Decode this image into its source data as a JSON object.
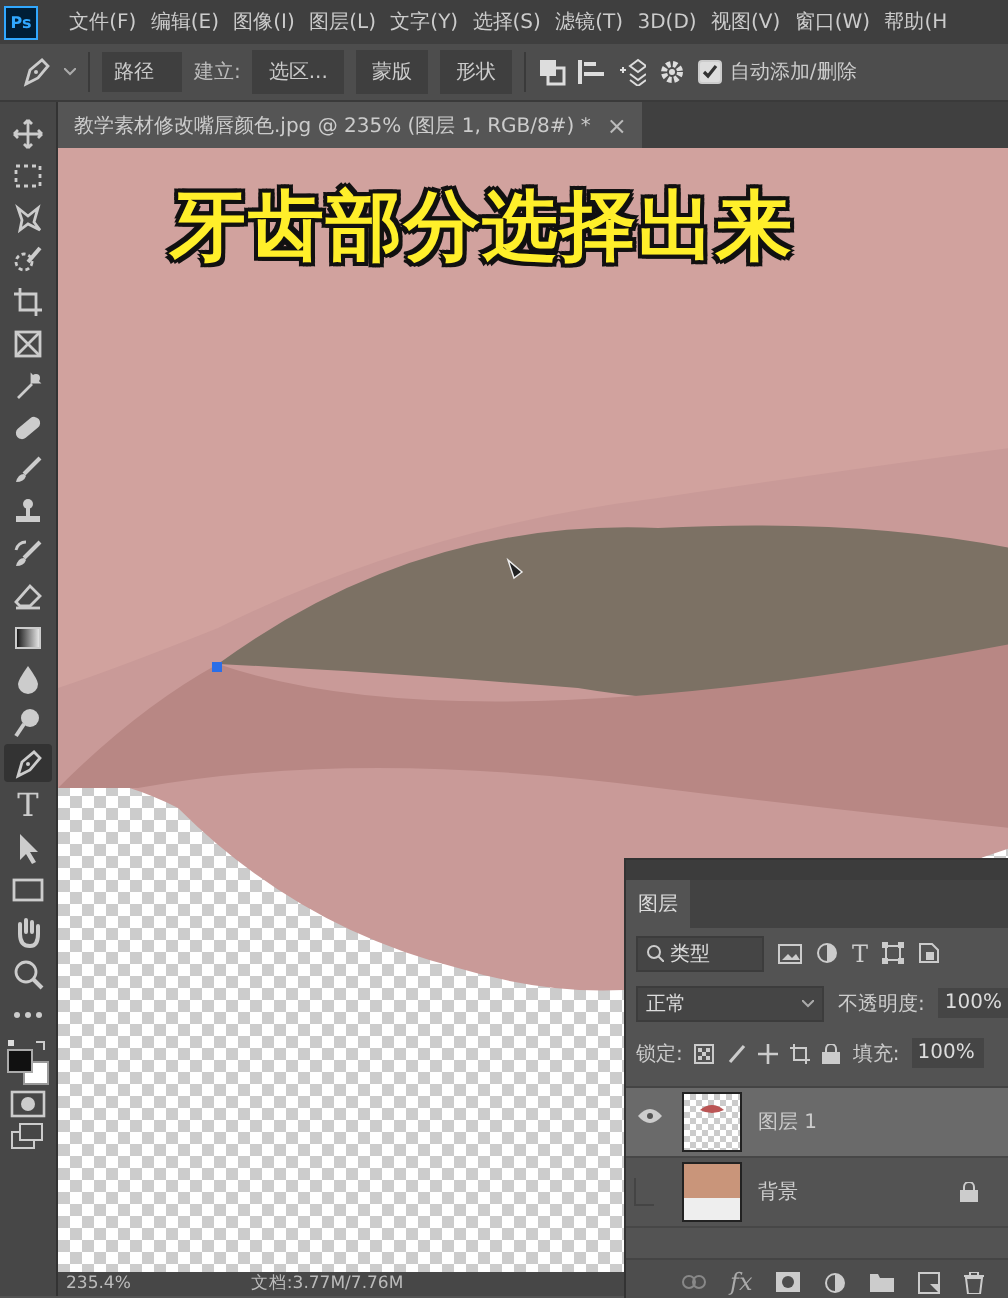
{
  "app_logo": "Ps",
  "menu": [
    "文件(F)",
    "编辑(E)",
    "图像(I)",
    "图层(L)",
    "文字(Y)",
    "选择(S)",
    "滤镜(T)",
    "3D(D)",
    "视图(V)",
    "窗口(W)",
    "帮助(H"
  ],
  "options_bar": {
    "mode": "路径",
    "make_label": "建立:",
    "buttons": [
      "选区...",
      "蒙版",
      "形状"
    ],
    "auto_add_delete": {
      "label": "自动添加/删除",
      "checked": true
    }
  },
  "document_tab": {
    "title": "教学素材修改嘴唇颜色.jpg @ 235% (图层 1, RGB/8#) *",
    "close": "×"
  },
  "tools": [
    {
      "kind": "move",
      "selected": false
    },
    {
      "kind": "marquee",
      "selected": false
    },
    {
      "kind": "lasso",
      "selected": false
    },
    {
      "kind": "quick-select",
      "selected": false
    },
    {
      "kind": "crop",
      "selected": false
    },
    {
      "kind": "frame",
      "selected": false
    },
    {
      "kind": "eyedropper",
      "selected": false
    },
    {
      "kind": "healing",
      "selected": false
    },
    {
      "kind": "brush",
      "selected": false
    },
    {
      "kind": "stamp",
      "selected": false
    },
    {
      "kind": "history-brush",
      "selected": false
    },
    {
      "kind": "eraser",
      "selected": false
    },
    {
      "kind": "gradient",
      "selected": false
    },
    {
      "kind": "blur",
      "selected": false
    },
    {
      "kind": "dodge",
      "selected": false
    },
    {
      "kind": "pen",
      "selected": true
    },
    {
      "kind": "type",
      "glyph": "T",
      "selected": false
    },
    {
      "kind": "path-select",
      "selected": false
    },
    {
      "kind": "rectangle",
      "selected": false
    },
    {
      "kind": "hand",
      "selected": false
    },
    {
      "kind": "zoom",
      "selected": false
    },
    {
      "kind": "more",
      "selected": false
    }
  ],
  "caption": "牙齿部分选择出来",
  "status_bar": {
    "zoom": "235.4%",
    "doc_size": "文档:3.77M/7.76M"
  },
  "layers_panel": {
    "tab": "图层",
    "filter": "类型",
    "filter_type_glyph": "T",
    "blend_mode": "正常",
    "opacity_label": "不透明度:",
    "opacity": "100%",
    "lock_label": "锁定:",
    "fill_label": "填充:",
    "fill": "100%",
    "fx_glyph": "fx",
    "layers": [
      {
        "name": "图层 1",
        "visible": true,
        "selected": true,
        "locked": false,
        "kind": "transparent"
      },
      {
        "name": "背景",
        "visible": false,
        "selected": false,
        "locked": true,
        "kind": "photo"
      }
    ]
  }
}
